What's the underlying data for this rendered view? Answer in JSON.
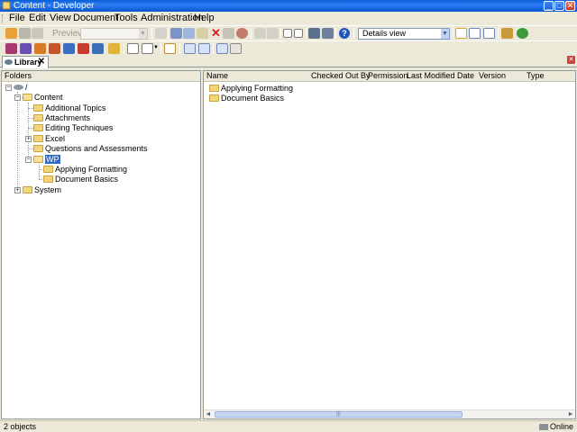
{
  "window": {
    "title": "Content - Developer",
    "minimize": "_",
    "maximize": "□",
    "close": "✕"
  },
  "menu": [
    "File",
    "Edit",
    "View",
    "Document",
    "Tools",
    "Administration",
    "Help"
  ],
  "toolbar": {
    "preview_label": "Preview",
    "view_select": "Details view"
  },
  "tabs": {
    "library_label": "Library",
    "close_glyph": "✕"
  },
  "folders_panel": {
    "header": "Folders",
    "tree": {
      "root": "/",
      "content": "Content",
      "content_children": [
        "Additional Topics",
        "Attachments",
        "Editing Techniques",
        "Excel",
        "Questions and Assessments",
        "WP"
      ],
      "wp_children": [
        "Applying Formatting",
        "Document Basics"
      ],
      "system": "System"
    }
  },
  "list_panel": {
    "columns": [
      "Name",
      "Checked Out By",
      "Permission",
      "Last Modified Date",
      "Version",
      "Type"
    ],
    "rows": [
      {
        "name": "Applying Formatting"
      },
      {
        "name": "Document Basics"
      }
    ]
  },
  "statusbar": {
    "count": "2 objects",
    "connection": "Online"
  },
  "colors": {
    "titlebar": "#0a5fd8",
    "selection": "#316ac5",
    "folder": "#f3d57a",
    "chrome": "#ece9d8"
  }
}
